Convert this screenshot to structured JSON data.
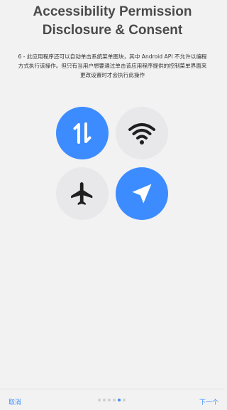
{
  "header": {
    "title": "Accessibility Permission Disclosure & Consent"
  },
  "main": {
    "description": "6 - 此应用程序还可以自动单击系统菜单图块，其中 Android API 不允许以编程方式执行该操作。但只有当用户想要通过单击该应用程序提供的控制菜单界面来更改设置时才会执行此操作",
    "tiles": [
      {
        "icon": "mobile-data-icon",
        "active": true
      },
      {
        "icon": "wifi-icon",
        "active": false
      },
      {
        "icon": "airplane-mode-icon",
        "active": false
      },
      {
        "icon": "location-icon",
        "active": true
      }
    ]
  },
  "footer": {
    "cancel_label": "取消",
    "next_label": "下一个",
    "page_indicator": {
      "total": 6,
      "current": 5
    }
  },
  "colors": {
    "accent": "#3d8cff",
    "tile_inactive": "#e8e8ea",
    "icon_dark": "#1f1f1f",
    "dot_inactive": "#cfcfcf",
    "link": "#3d8cff",
    "background": "#f2f2f2"
  }
}
